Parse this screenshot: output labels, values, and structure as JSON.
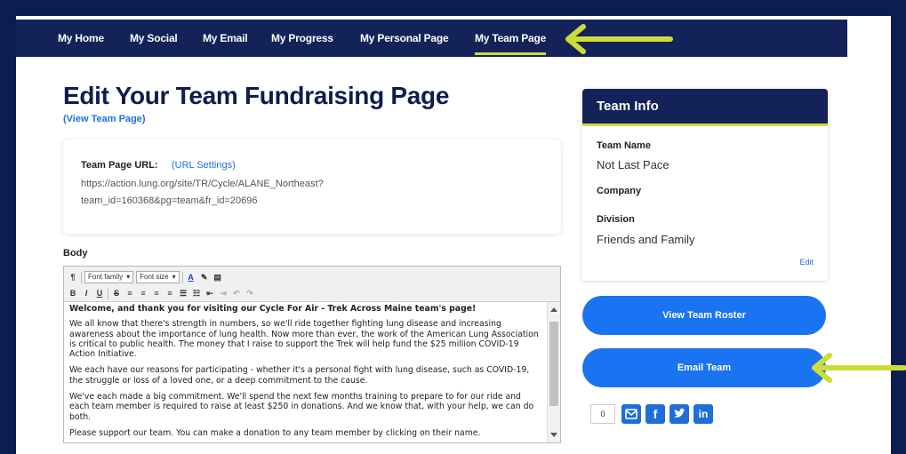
{
  "nav": {
    "items": [
      {
        "label": "My Home"
      },
      {
        "label": "My Social"
      },
      {
        "label": "My Email"
      },
      {
        "label": "My Progress"
      },
      {
        "label": "My Personal Page"
      },
      {
        "label": "My Team Page"
      }
    ],
    "active": "My Team Page"
  },
  "main": {
    "title": "Edit Your Team Fundraising Page",
    "view_link": "(View Team Page)",
    "url_label": "Team Page URL:",
    "url_settings": "(URL Settings)",
    "url_line1": "https://action.lung.org/site/TR/Cycle/ALANE_Northeast?",
    "url_line2": "team_id=160368&pg=team&fr_id=20696",
    "body_label": "Body"
  },
  "editor": {
    "font_family": "Font family",
    "font_size": "Font size",
    "paragraphs": [
      "Welcome, and thank you for visiting our Cycle For Air - Trek Across Maine team's page!",
      "We all know that there's strength in numbers, so we'll ride together fighting lung disease and increasing awareness about the importance of lung health. Now more than ever, the work of the American Lung Association is critical to public health. The money that I raise to support the Trek will help fund the $25 million COVID-19 Action Initiative.",
      "We each have our reasons for participating - whether it's a personal fight with lung disease, such as COVID-19, the struggle or loss of a loved one, or a deep commitment to the cause.",
      "We've each made a big commitment. We'll spend the next few months training to prepare to for our ride and each team member is required to raise at least $250 in donations. And we know that, with your help, we can do both.",
      "Please support our team. You can make a donation to any team member by clicking on their name."
    ]
  },
  "team_info": {
    "heading": "Team Info",
    "name_label": "Team Name",
    "name_value": "Not Last Pace",
    "company_label": "Company",
    "division_label": "Division",
    "division_value": "Friends and Family",
    "edit": "Edit"
  },
  "buttons": {
    "roster": "View Team Roster",
    "email": "Email Team"
  },
  "social": {
    "count": "0",
    "icons": [
      "email-share-icon",
      "facebook-icon",
      "twitter-icon",
      "linkedin-icon"
    ]
  },
  "colors": {
    "navy": "#132258",
    "accent": "#cddc39",
    "button_blue": "#1a73f0",
    "link_blue": "#1f6fe0"
  }
}
